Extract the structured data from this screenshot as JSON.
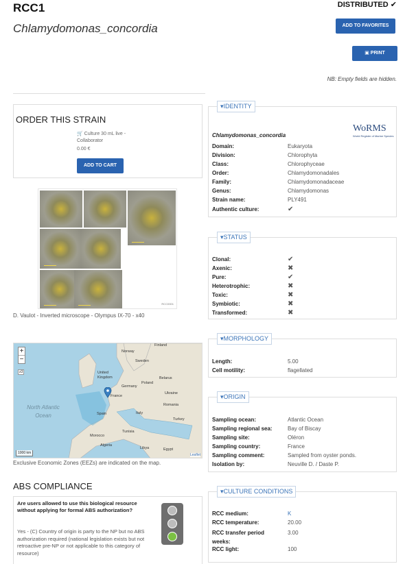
{
  "header": {
    "title": "RCC1",
    "species": "Chlamydomonas_concordia",
    "distributed_label": "DISTRIBUTED",
    "add_favorites_label": "ADD TO FAVORITES",
    "print_label": "PRINT",
    "nb_text": "NB: Empty fields are hidden."
  },
  "order": {
    "title": "ORDER THIS STRAIN",
    "item": "Culture 30 mL live - Collaborator",
    "price": "0.00 €",
    "add_to_cart_label": "ADD TO CART"
  },
  "photo": {
    "caption": "D. Vaulot - Inverted microscope - Olympus IX-70 - x40",
    "scale_labels": [
      "5.0 µm",
      "5.0 µm",
      "5.0 µm",
      "5.0 µm"
    ],
    "image_id": "RCC0001"
  },
  "map": {
    "caption": "Exclusive Economic Zones (EEZs) are indicated on the map.",
    "zoom_in": "+",
    "zoom_out": "−",
    "zoom_level": "z3",
    "scale_label": "1000 km",
    "sea_label": "North Atlantic Ocean",
    "attribution": "Leaflet",
    "countries": [
      "Finland",
      "Norway",
      "Sweden",
      "United Kingdom",
      "Germany",
      "Poland",
      "Belarus",
      "Ukraine",
      "France",
      "Spain",
      "Italy",
      "Romania",
      "Turkey",
      "Morocco",
      "Tunisia",
      "Algeria",
      "Libya",
      "Egypt"
    ]
  },
  "abs": {
    "title": "ABS COMPLIANCE",
    "question": "Are users allowed to use this biological resource without applying for formal ABS authorization?",
    "answer": "Yes - (C) Country of origin is party to the NP but no ABS authorization required (national legislation exists but not retroactive pre-NP or not applicable to this category of resource)",
    "light_colors": {
      "off": "#bdbdbd",
      "active": "#7bc043"
    }
  },
  "identity": {
    "legend": "IDENTITY",
    "species": "Chlamydomonas_concordia",
    "logo": "WoRMS",
    "logo_sub": "World Register of Marine Species",
    "rows": [
      {
        "k": "Domain:",
        "v": "Eukaryota"
      },
      {
        "k": "Division:",
        "v": "Chlorophyta"
      },
      {
        "k": "Class:",
        "v": "Chlorophyceae"
      },
      {
        "k": "Order:",
        "v": "Chlamydomonadales"
      },
      {
        "k": "Family:",
        "v": "Chlamydomonadaceae"
      },
      {
        "k": "Genus:",
        "v": "Chlamydomonas"
      },
      {
        "k": "Strain name:",
        "v": "PLY491"
      },
      {
        "k": "Authentic culture:",
        "v": "✔"
      }
    ]
  },
  "status": {
    "legend": "STATUS",
    "rows": [
      {
        "k": "Clonal:",
        "v": "✔"
      },
      {
        "k": "Axenic:",
        "v": "✖"
      },
      {
        "k": "Pure:",
        "v": "✔"
      },
      {
        "k": "Heterotrophic:",
        "v": "✖"
      },
      {
        "k": "Toxic:",
        "v": "✖"
      },
      {
        "k": "Symbiotic:",
        "v": "✖"
      },
      {
        "k": "Transformed:",
        "v": "✖"
      }
    ]
  },
  "morphology": {
    "legend": "MORPHOLOGY",
    "rows": [
      {
        "k": "Length:",
        "v": "5.00"
      },
      {
        "k": "Cell motility:",
        "v": "flagellated"
      }
    ]
  },
  "origin": {
    "legend": "ORIGIN",
    "rows": [
      {
        "k": "Sampling ocean:",
        "v": "Atlantic Ocean"
      },
      {
        "k": "Sampling regional sea:",
        "v": "Bay of Biscay"
      },
      {
        "k": "Sampling site:",
        "v": "Oléron"
      },
      {
        "k": "Sampling country:",
        "v": "France"
      },
      {
        "k": "Sampling comment:",
        "v": "Sampled from oyster ponds."
      },
      {
        "k": "Isolation by:",
        "v": "Neuville D. / Daste P."
      }
    ]
  },
  "culture": {
    "legend": "CULTURE CONDITIONS",
    "rows": [
      {
        "k": "RCC medium:",
        "v": "K"
      },
      {
        "k": "RCC temperature:",
        "v": "20.00"
      },
      {
        "k": "RCC transfer period weeks:",
        "v": "3.00"
      },
      {
        "k": "RCC light:",
        "v": "100"
      }
    ]
  },
  "colors": {
    "accent": "#2a63b0",
    "legend": "#3b74b8"
  }
}
